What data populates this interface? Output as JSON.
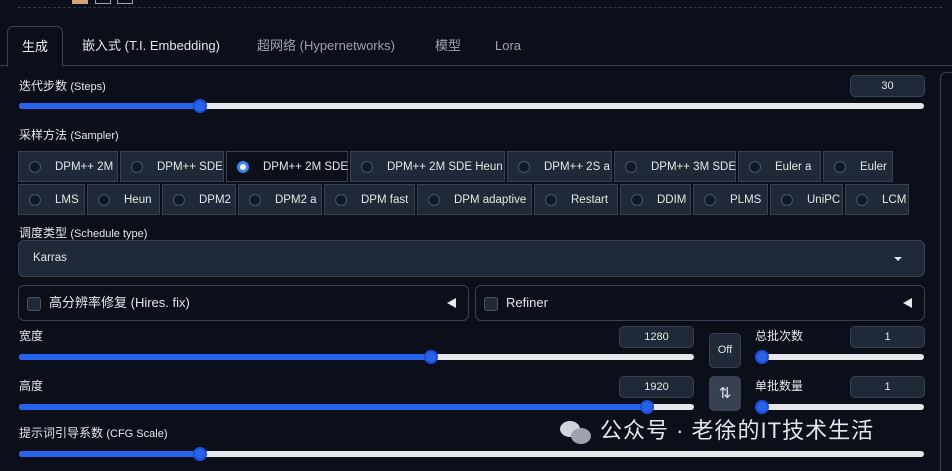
{
  "tabs": [
    {
      "label": "生成",
      "active": true
    },
    {
      "label": "嵌入式 (T.I. Embedding)",
      "active": false
    },
    {
      "label": "超网络 (Hypernetworks)",
      "active": false
    },
    {
      "label": "模型",
      "active": false
    },
    {
      "label": "Lora",
      "active": false
    }
  ],
  "steps": {
    "label": "迭代步数",
    "label_en": "(Steps)",
    "value": "30",
    "fraction": 0.2
  },
  "sampler": {
    "label": "采样方法",
    "label_en": "(Sampler)",
    "selected": "DPM++ 2M SDE",
    "row1": [
      "DPM++ 2M",
      "DPM++ SDE",
      "DPM++ 2M SDE",
      "DPM++ 2M SDE Heun",
      "DPM++ 2S a",
      "DPM++ 3M SDE",
      "Euler a",
      "Euler"
    ],
    "row2": [
      "LMS",
      "Heun",
      "DPM2",
      "DPM2 a",
      "DPM fast",
      "DPM adaptive",
      "Restart",
      "DDIM",
      "PLMS",
      "UniPC",
      "LCM"
    ]
  },
  "schedule": {
    "label": "调度类型",
    "label_en": "(Schedule type)",
    "value": "Karras"
  },
  "hires": {
    "label": "高分辨率修复 (Hires. fix)"
  },
  "refiner": {
    "label": "Refiner"
  },
  "width": {
    "label": "宽度",
    "value": "1280",
    "fraction": 0.61
  },
  "height": {
    "label": "高度",
    "value": "1920",
    "fraction": 0.93
  },
  "batch_count": {
    "label": "总批次数",
    "value": "1",
    "fraction": 0.0
  },
  "batch_size": {
    "label": "单批数量",
    "value": "1",
    "fraction": 0.0
  },
  "off_button": {
    "label": "Off"
  },
  "swap_button": {
    "label": "⇅"
  },
  "cfg": {
    "label": "提示词引导系数",
    "label_en": "(CFG Scale)",
    "fraction": 0.2
  },
  "watermark": {
    "text": "公众号 · 老徐的IT技术生活"
  },
  "colors": {
    "accent": "#2563eb",
    "background": "#0b0f19",
    "panel": "#1f2937"
  }
}
